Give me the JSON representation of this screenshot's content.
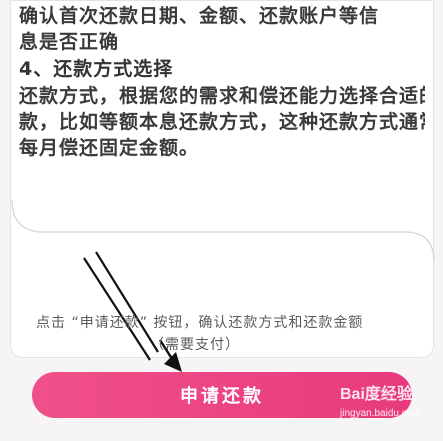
{
  "article": {
    "paragraph_lines": [
      "确认首次还款日期、金额、还款账户等信",
      "息是否正确"
    ],
    "section_heading": "4、还款方式选择",
    "section_lines": [
      "还款方式，根据您的需求和偿还能力选择合适的还",
      "款，比如等额本息还款方式，这种还款方式通常是",
      "每月偿还固定金额。"
    ]
  },
  "instruction": {
    "line1": "点击 “申请还款” 按钮，确认还款方式和还款金额",
    "line2": "（需要支付）"
  },
  "apply_button": {
    "label": "申请还款"
  },
  "watermark": {
    "brand": "Bai度经验",
    "url": "jingyan.baidu.com"
  },
  "colors": {
    "button_gradient_start": "#f0508a",
    "button_gradient_end": "#e83a7c",
    "arrow": "#111111"
  }
}
